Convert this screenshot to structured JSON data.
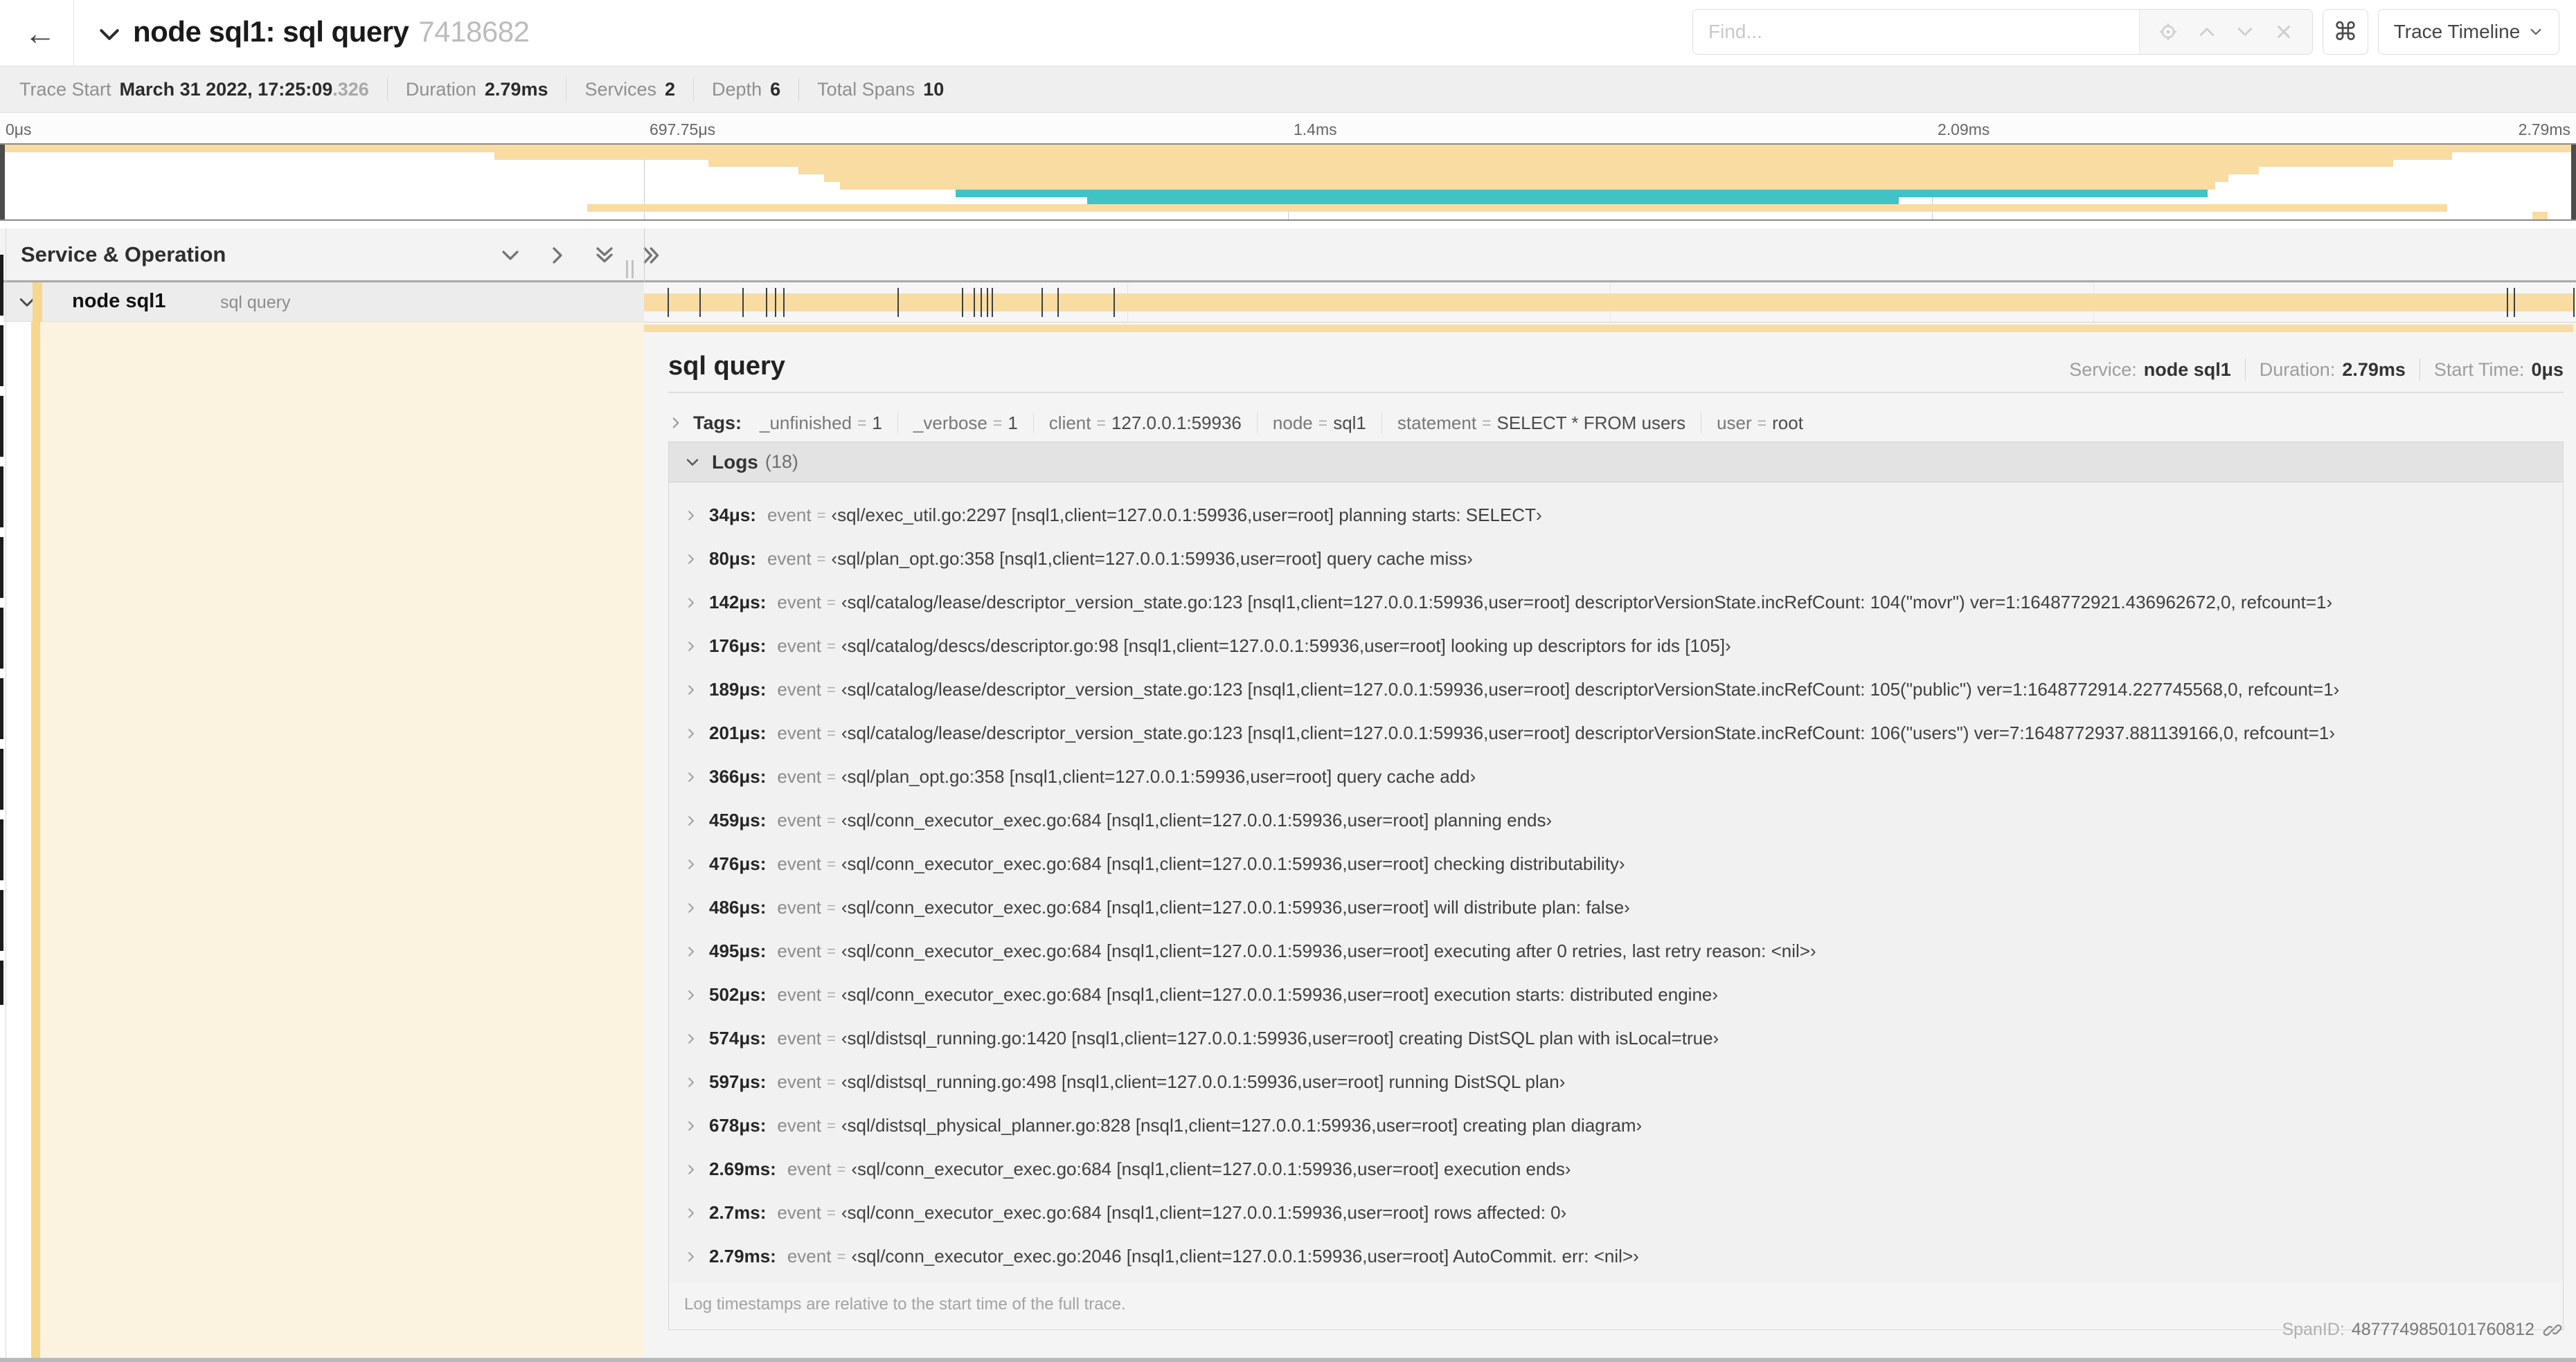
{
  "header": {
    "back_icon": "←",
    "title": "node sql1: sql query",
    "trace_id": "7418682",
    "find_placeholder": "Find...",
    "shortcut_icon": "⌘",
    "view_select_label": "Trace Timeline"
  },
  "summary": {
    "items": [
      {
        "label": "Trace Start",
        "value": "March 31 2022, 17:25:09",
        "suffix": ".326"
      },
      {
        "label": "Duration",
        "value": "2.79ms",
        "suffix": ""
      },
      {
        "label": "Services",
        "value": "2",
        "suffix": ""
      },
      {
        "label": "Depth",
        "value": "6",
        "suffix": ""
      },
      {
        "label": "Total Spans",
        "value": "10",
        "suffix": ""
      }
    ]
  },
  "timeline": {
    "ticks": [
      "0μs",
      "697.75μs",
      "1.4ms",
      "2.09ms",
      "2.79ms"
    ],
    "colors": {
      "tan": "#f8dca2",
      "teal": "#3fc3c7",
      "tan_dark": "#f5d78e",
      "cream": "#fbf2e0"
    },
    "minimap_spans": [
      {
        "start": 0,
        "end": 100,
        "color": "tan"
      },
      {
        "start": 19.2,
        "end": 95.2,
        "color": "tan"
      },
      {
        "start": 27.5,
        "end": 92.9,
        "color": "tan"
      },
      {
        "start": 31.0,
        "end": 87.7,
        "color": "tan"
      },
      {
        "start": 32.0,
        "end": 86.5,
        "color": "tan"
      },
      {
        "start": 32.6,
        "end": 86.0,
        "color": "tan"
      },
      {
        "start": 37.1,
        "end": 85.7,
        "color": "teal"
      },
      {
        "start": 42.2,
        "end": 73.7,
        "color": "teal"
      },
      {
        "start": 22.8,
        "end": 95.0,
        "color": "tan"
      },
      {
        "start": 98.3,
        "end": 98.9,
        "color": "tan"
      }
    ]
  },
  "span_table": {
    "header": "Service & Operation",
    "row": {
      "service": "node sql1",
      "operation": "sql query"
    },
    "log_marker_positions": [
      1.22,
      2.87,
      5.09,
      6.31,
      6.78,
      7.21,
      13.12,
      16.45,
      17.06,
      17.42,
      17.74,
      17.99,
      20.57,
      21.4,
      24.3,
      96.42,
      96.77,
      99.85
    ]
  },
  "detail": {
    "title": "sql query",
    "meta": [
      {
        "label": "Service:",
        "value": "node sql1"
      },
      {
        "label": "Duration:",
        "value": "2.79ms"
      },
      {
        "label": "Start Time:",
        "value": "0μs"
      }
    ],
    "tags": {
      "label": "Tags:",
      "items": [
        {
          "key": "_unfinished",
          "value": "1"
        },
        {
          "key": "_verbose",
          "value": "1"
        },
        {
          "key": "client",
          "value": "127.0.0.1:59936"
        },
        {
          "key": "node",
          "value": "sql1"
        },
        {
          "key": "statement",
          "value": "SELECT * FROM users"
        },
        {
          "key": "user",
          "value": "root"
        }
      ]
    },
    "logs": {
      "label": "Logs",
      "count": "(18)",
      "key_label": "event",
      "entries": [
        {
          "time": "34μs:",
          "value": "‹sql/exec_util.go:2297 [nsql1,client=127.0.0.1:59936,user=root] planning starts: SELECT›"
        },
        {
          "time": "80μs:",
          "value": "‹sql/plan_opt.go:358 [nsql1,client=127.0.0.1:59936,user=root] query cache miss›"
        },
        {
          "time": "142μs:",
          "value": "‹sql/catalog/lease/descriptor_version_state.go:123 [nsql1,client=127.0.0.1:59936,user=root] descriptorVersionState.incRefCount: 104(\"movr\") ver=1:1648772921.436962672,0, refcount=1›"
        },
        {
          "time": "176μs:",
          "value": "‹sql/catalog/descs/descriptor.go:98 [nsql1,client=127.0.0.1:59936,user=root] looking up descriptors for ids [105]›"
        },
        {
          "time": "189μs:",
          "value": "‹sql/catalog/lease/descriptor_version_state.go:123 [nsql1,client=127.0.0.1:59936,user=root] descriptorVersionState.incRefCount: 105(\"public\") ver=1:1648772914.227745568,0, refcount=1›"
        },
        {
          "time": "201μs:",
          "value": "‹sql/catalog/lease/descriptor_version_state.go:123 [nsql1,client=127.0.0.1:59936,user=root] descriptorVersionState.incRefCount: 106(\"users\") ver=7:1648772937.881139166,0, refcount=1›"
        },
        {
          "time": "366μs:",
          "value": "‹sql/plan_opt.go:358 [nsql1,client=127.0.0.1:59936,user=root] query cache add›"
        },
        {
          "time": "459μs:",
          "value": "‹sql/conn_executor_exec.go:684 [nsql1,client=127.0.0.1:59936,user=root] planning ends›"
        },
        {
          "time": "476μs:",
          "value": "‹sql/conn_executor_exec.go:684 [nsql1,client=127.0.0.1:59936,user=root] checking distributability›"
        },
        {
          "time": "486μs:",
          "value": "‹sql/conn_executor_exec.go:684 [nsql1,client=127.0.0.1:59936,user=root] will distribute plan: false›"
        },
        {
          "time": "495μs:",
          "value": "‹sql/conn_executor_exec.go:684 [nsql1,client=127.0.0.1:59936,user=root] executing after 0 retries, last retry reason: <nil>›"
        },
        {
          "time": "502μs:",
          "value": "‹sql/conn_executor_exec.go:684 [nsql1,client=127.0.0.1:59936,user=root] execution starts: distributed engine›"
        },
        {
          "time": "574μs:",
          "value": "‹sql/distsql_running.go:1420 [nsql1,client=127.0.0.1:59936,user=root] creating DistSQL plan with isLocal=true›"
        },
        {
          "time": "597μs:",
          "value": "‹sql/distsql_running.go:498 [nsql1,client=127.0.0.1:59936,user=root] running DistSQL plan›"
        },
        {
          "time": "678μs:",
          "value": "‹sql/distsql_physical_planner.go:828 [nsql1,client=127.0.0.1:59936,user=root] creating plan diagram›"
        },
        {
          "time": "2.69ms:",
          "value": "‹sql/conn_executor_exec.go:684 [nsql1,client=127.0.0.1:59936,user=root] execution ends›"
        },
        {
          "time": "2.7ms:",
          "value": "‹sql/conn_executor_exec.go:684 [nsql1,client=127.0.0.1:59936,user=root] rows affected: 0›"
        },
        {
          "time": "2.79ms:",
          "value": "‹sql/conn_executor_exec.go:2046 [nsql1,client=127.0.0.1:59936,user=root] AutoCommit. err: <nil>›"
        }
      ],
      "footnote": "Log timestamps are relative to the start time of the full trace."
    },
    "span_id_label": "SpanID:",
    "span_id": "4877749850101760812"
  }
}
